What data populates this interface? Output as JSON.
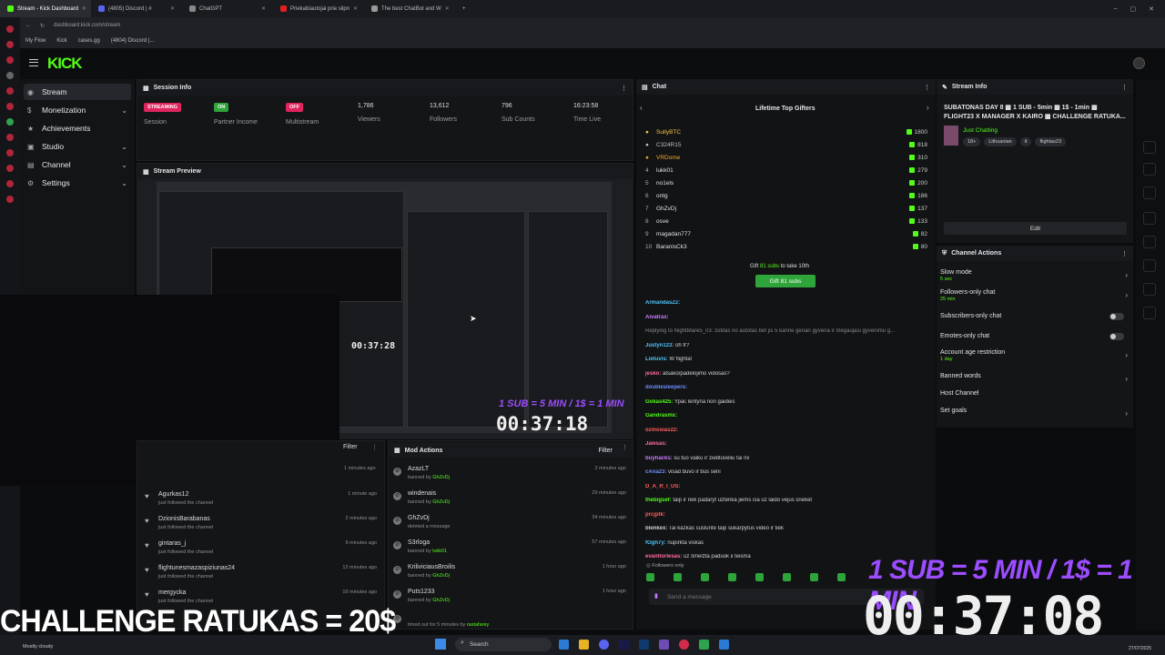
{
  "browser": {
    "tabs": [
      {
        "label": "Stream - Kick Dashboard",
        "color": "#53fc18",
        "active": true
      },
      {
        "label": "(4805) Discord | #",
        "color": "#5865f2"
      },
      {
        "label": "ChatGPT",
        "color": "#888888"
      },
      {
        "label": "Priekabiautojai prie silpn",
        "color": "#e02020"
      },
      {
        "label": "The best ChatBot and W",
        "color": "#999999"
      }
    ],
    "new_tab": "+",
    "url": "dashboard.kick.com/stream",
    "bookmarks": [
      "My Flow",
      "Kick",
      "cases.gg",
      "(4804) Discord |..."
    ]
  },
  "header": {
    "logo": "KICK"
  },
  "sidebar": {
    "items": [
      {
        "label": "Stream",
        "icon": "◉",
        "chev": ""
      },
      {
        "label": "Monetization",
        "icon": "$",
        "chev": "⌄"
      },
      {
        "label": "Achievements",
        "icon": "★",
        "chev": ""
      },
      {
        "label": "Studio",
        "icon": "▣",
        "chev": "⌄"
      },
      {
        "label": "Channel",
        "icon": "▤",
        "chev": "⌄"
      },
      {
        "label": "Settings",
        "icon": "⚙",
        "chev": "⌄"
      }
    ]
  },
  "session": {
    "title": "Session Info",
    "streaming_badge": "STREAMING",
    "streaming_label": "Session",
    "partner_badge": "ON",
    "partner_label": "Partner Income",
    "multi_badge": "OFF",
    "multi_label": "Multistream",
    "viewers": "1,786",
    "viewers_label": "Viewers",
    "followers": "13,612",
    "followers_label": "Followers",
    "subs": "796",
    "subs_label": "Sub Counts",
    "time": "16:23:58",
    "time_label": "Time Live"
  },
  "preview": {
    "title": "Stream Preview",
    "small_timer": "00:37:28",
    "sub_text": "1 SUB = 5 MIN / 1$ = 1 MIN",
    "timer": "00:37:18"
  },
  "feed": {
    "filter": "Filter",
    "top_time": "1 minutes ago",
    "items": [
      {
        "name": "Agurkas12",
        "sub": "just followed the channel",
        "time": "1 minute ago"
      },
      {
        "name": "DzionisBarabanas",
        "sub": "just followed the channel",
        "time": "2 minutes ago"
      },
      {
        "name": "gintaras_j",
        "sub": "just followed the channel",
        "time": "9 minutes ago"
      },
      {
        "name": "flightunesmazaspiziunas24",
        "sub": "just followed the channel",
        "time": "12 minutes ago"
      },
      {
        "name": "mergycka",
        "sub": "just followed the channel",
        "time": "16 minutes ago"
      }
    ]
  },
  "mod": {
    "title": "Mod Actions",
    "filter": "Filter",
    "items": [
      {
        "name": "AzazLT",
        "action": "banned by",
        "by": "GhZvDj",
        "time": "2 minutes ago"
      },
      {
        "name": "windenais",
        "action": "banned by",
        "by": "GhZvDj",
        "time": "29 minutes ago"
      },
      {
        "name": "GhZvDj",
        "action": "deleted a message",
        "by": "",
        "time": "34 minutes ago"
      },
      {
        "name": "S3rloga",
        "action": "banned by",
        "by": "lukk01",
        "time": "57 minutes ago"
      },
      {
        "name": "KriliviciausBroilis",
        "action": "banned by",
        "by": "GhZvDj",
        "time": "1 hour ago"
      },
      {
        "name": "Puts1233",
        "action": "banned by",
        "by": "GhZvDj",
        "time": "1 hour ago"
      },
      {
        "name": "",
        "action": "timed out for 5 minutes by",
        "by": "rastafarey",
        "time": ""
      }
    ]
  },
  "chat": {
    "title": "Chat",
    "gifters_title": "Lifetime Top Gifters",
    "gifters": [
      {
        "rank": "",
        "name": "SullyBTC",
        "count": "1800",
        "color": "#f5c542"
      },
      {
        "rank": "",
        "name": "C324R15",
        "count": "818",
        "color": "#c0c0c0"
      },
      {
        "rank": "",
        "name": "VRDome",
        "count": "310",
        "color": "#f5a623"
      },
      {
        "rank": "4",
        "name": "lukk01",
        "count": "279",
        "color": "#e0e0e0"
      },
      {
        "rank": "5",
        "name": "no1els",
        "count": "200",
        "color": "#e0e0e0"
      },
      {
        "rank": "6",
        "name": "ontg",
        "count": "186",
        "color": "#e0e0e0"
      },
      {
        "rank": "7",
        "name": "GhZvDj",
        "count": "137",
        "color": "#e0e0e0"
      },
      {
        "rank": "8",
        "name": "osve",
        "count": "133",
        "color": "#e0e0e0"
      },
      {
        "rank": "9",
        "name": "magadan777",
        "count": "82",
        "color": "#e0e0e0"
      },
      {
        "rank": "10",
        "name": "BaranisCk3",
        "count": "80",
        "color": "#e0e0e0"
      }
    ],
    "gift_prompt_pre": "Gift",
    "gift_prompt_subs": "81 subs",
    "gift_prompt_post": "to take 10th",
    "gift_button": "Gift 81 subs",
    "messages": [
      {
        "user": "ArmandasZz:",
        "text": "",
        "color": "#4fc3f7"
      },
      {
        "user": "Aivatrax:",
        "text": "",
        "color": "#c77dff"
      },
      {
        "user": "",
        "text": "Replying to NightMare5_03: zotitas no autotas bet jis 5 karine gerian gyvena ir megaujasi gyvenimu g...",
        "color": "#888888"
      },
      {
        "user": "Justyn123:",
        "text": "oh fr?",
        "color": "#4fc3f7"
      },
      {
        "user": "Lietuvis:",
        "text": "W flighta!",
        "color": "#4fc3f7"
      },
      {
        "user": "jesko:",
        "text": "atsako/padelojimo vidosas?",
        "color": "#ff6b9d"
      },
      {
        "user": "doublesleepers:",
        "text": "",
        "color": "#6c8cff"
      },
      {
        "user": "Gokas425:",
        "text": "Ypac lentyna nori gaideis",
        "color": "#53fc18"
      },
      {
        "user": "Gandrasmx:",
        "text": "",
        "color": "#53fc18"
      },
      {
        "user": "ozmosias22:",
        "text": "",
        "color": "#ff5e5e"
      },
      {
        "user": "Jalesas:",
        "text": "",
        "color": "#ff6b9d"
      },
      {
        "user": "buyhacks:",
        "text": "su tuo vaiku ir ziebtuveliu tai nx",
        "color": "#c77dff"
      },
      {
        "user": "cAna23:",
        "text": "visad buvo ir bus seni",
        "color": "#6c8cff"
      },
      {
        "user": "D_A_R_I_US:",
        "text": "",
        "color": "#ff5e5e"
      },
      {
        "user": "thebigsef:",
        "text": "taip ir reik padaryt uztenka jiems cia uz laido vejus sneket",
        "color": "#53fc18"
      },
      {
        "user": "prcjptk:",
        "text": "",
        "color": "#ff5e5e"
      },
      {
        "user": "blenkex:",
        "text": "Tai kazkas suslunte taip sukarpytus video ir tiek",
        "color": "#d2d3d6"
      },
      {
        "user": "fOgh7y:",
        "text": "nupirkta viskas",
        "color": "#4fc3f7"
      },
      {
        "user": "evantlorlesas:",
        "text": "uz šmelžta paduok ii teisma",
        "color": "#ff6b9d"
      }
    ],
    "followers_only": "Followers only",
    "input_placeholder": "Send a message"
  },
  "stream_info": {
    "title": "Stream Info",
    "stream_title": "SUBATONAS DAY 8 ▩ 1 SUB - 5min ▩ 1$ - 1min ▩ FLIGHT23 X MANAGER X KAIRO ▩ CHALLENGE RATUKA...",
    "category": "Just Chatting",
    "tags": [
      "18+",
      "Lithuanian",
      "lt",
      "flightas23"
    ],
    "edit": "Edit"
  },
  "channel_actions": {
    "title": "Channel Actions",
    "items": [
      {
        "label": "Slow mode",
        "detail": "5 sec",
        "control": "chev"
      },
      {
        "label": "Followers-only chat",
        "detail": "25 min",
        "control": "chev"
      },
      {
        "label": "Subscribers-only chat",
        "detail": "",
        "control": "toggle"
      },
      {
        "label": "Emotes-only chat",
        "detail": "",
        "control": "toggle"
      },
      {
        "label": "Account age restriction",
        "detail": "1 day",
        "control": "chev"
      },
      {
        "label": "Banned words",
        "detail": "",
        "control": "chev"
      },
      {
        "label": "Host Channel",
        "detail": "",
        "control": ""
      },
      {
        "label": "Set goals",
        "detail": "",
        "control": "chev"
      }
    ]
  },
  "overlay": {
    "challenge": "CHALLENGE RATUKAS = 20$",
    "sub_rate": "1 SUB = 5 MIN / 1$ = 1 MIN",
    "timer": "00:37:08"
  },
  "taskbar": {
    "weather": "Mostly cloudy",
    "search": "Search",
    "date": "27/07/2025"
  },
  "colors": {
    "accent": "#53fc18",
    "purple": "#9b4dff"
  }
}
